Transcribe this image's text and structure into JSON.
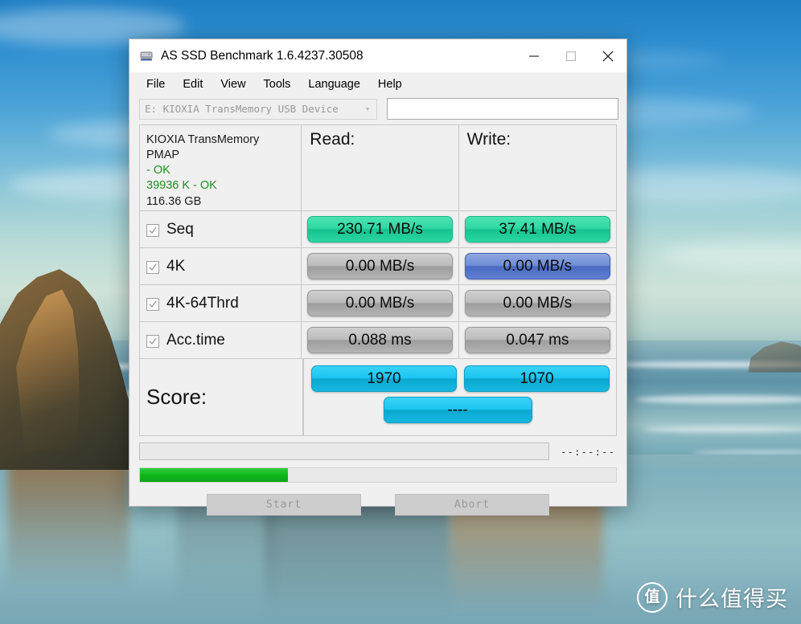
{
  "window": {
    "title": "AS SSD Benchmark 1.6.4237.30508",
    "icon": "hdd-icon",
    "controls": {
      "minimize": "minimize-icon",
      "maximize": "maximize-icon",
      "close": "close-icon"
    }
  },
  "menu": {
    "items": [
      "File",
      "Edit",
      "View",
      "Tools",
      "Language",
      "Help"
    ]
  },
  "device_bar": {
    "combo_value": "E: KIOXIA TransMemory USB Device",
    "combo_arrow": "chevron-down-icon",
    "name_value": "",
    "name_placeholder": ""
  },
  "device_info": {
    "lines": [
      {
        "text": "KIOXIA TransMemory",
        "green": false
      },
      {
        "text": "PMAP",
        "green": false
      },
      {
        "text": " - OK",
        "green": true
      },
      {
        "text": "39936 K - OK",
        "green": true
      },
      {
        "text": "116.36 GB",
        "green": false
      }
    ]
  },
  "columns": {
    "read": "Read:",
    "write": "Write:"
  },
  "rows": [
    {
      "label": "Seq",
      "checked": true,
      "read": "230.71 MB/s",
      "read_style": "teal",
      "write": "37.41 MB/s",
      "write_style": "teal"
    },
    {
      "label": "4K",
      "checked": true,
      "read": "0.00 MB/s",
      "read_style": "gray",
      "write": "0.00 MB/s",
      "write_style": "blue"
    },
    {
      "label": "4K-64Thrd",
      "checked": true,
      "read": "0.00 MB/s",
      "read_style": "gray",
      "write": "0.00 MB/s",
      "write_style": "gray"
    },
    {
      "label": "Acc.time",
      "checked": true,
      "read": "0.088 ms",
      "read_style": "gray",
      "write": "0.047 ms",
      "write_style": "gray"
    }
  ],
  "score": {
    "title": "Score:",
    "read": "1970",
    "write": "1070",
    "total": "----"
  },
  "status": {
    "log_text": "",
    "elapsed": "--:--:--",
    "progress_percent": 31
  },
  "buttons": {
    "start": "Start",
    "abort": "Abort"
  },
  "watermark": {
    "badge": "值",
    "text": "什么值得买"
  },
  "colors": {
    "teal": "#2fd8a3",
    "blue": "#4a6ac4",
    "cyan": "#1ec5f0",
    "gray": "#bdbdbd",
    "progress_green": "#0fb71c",
    "status_green": "#1f8f1f"
  }
}
